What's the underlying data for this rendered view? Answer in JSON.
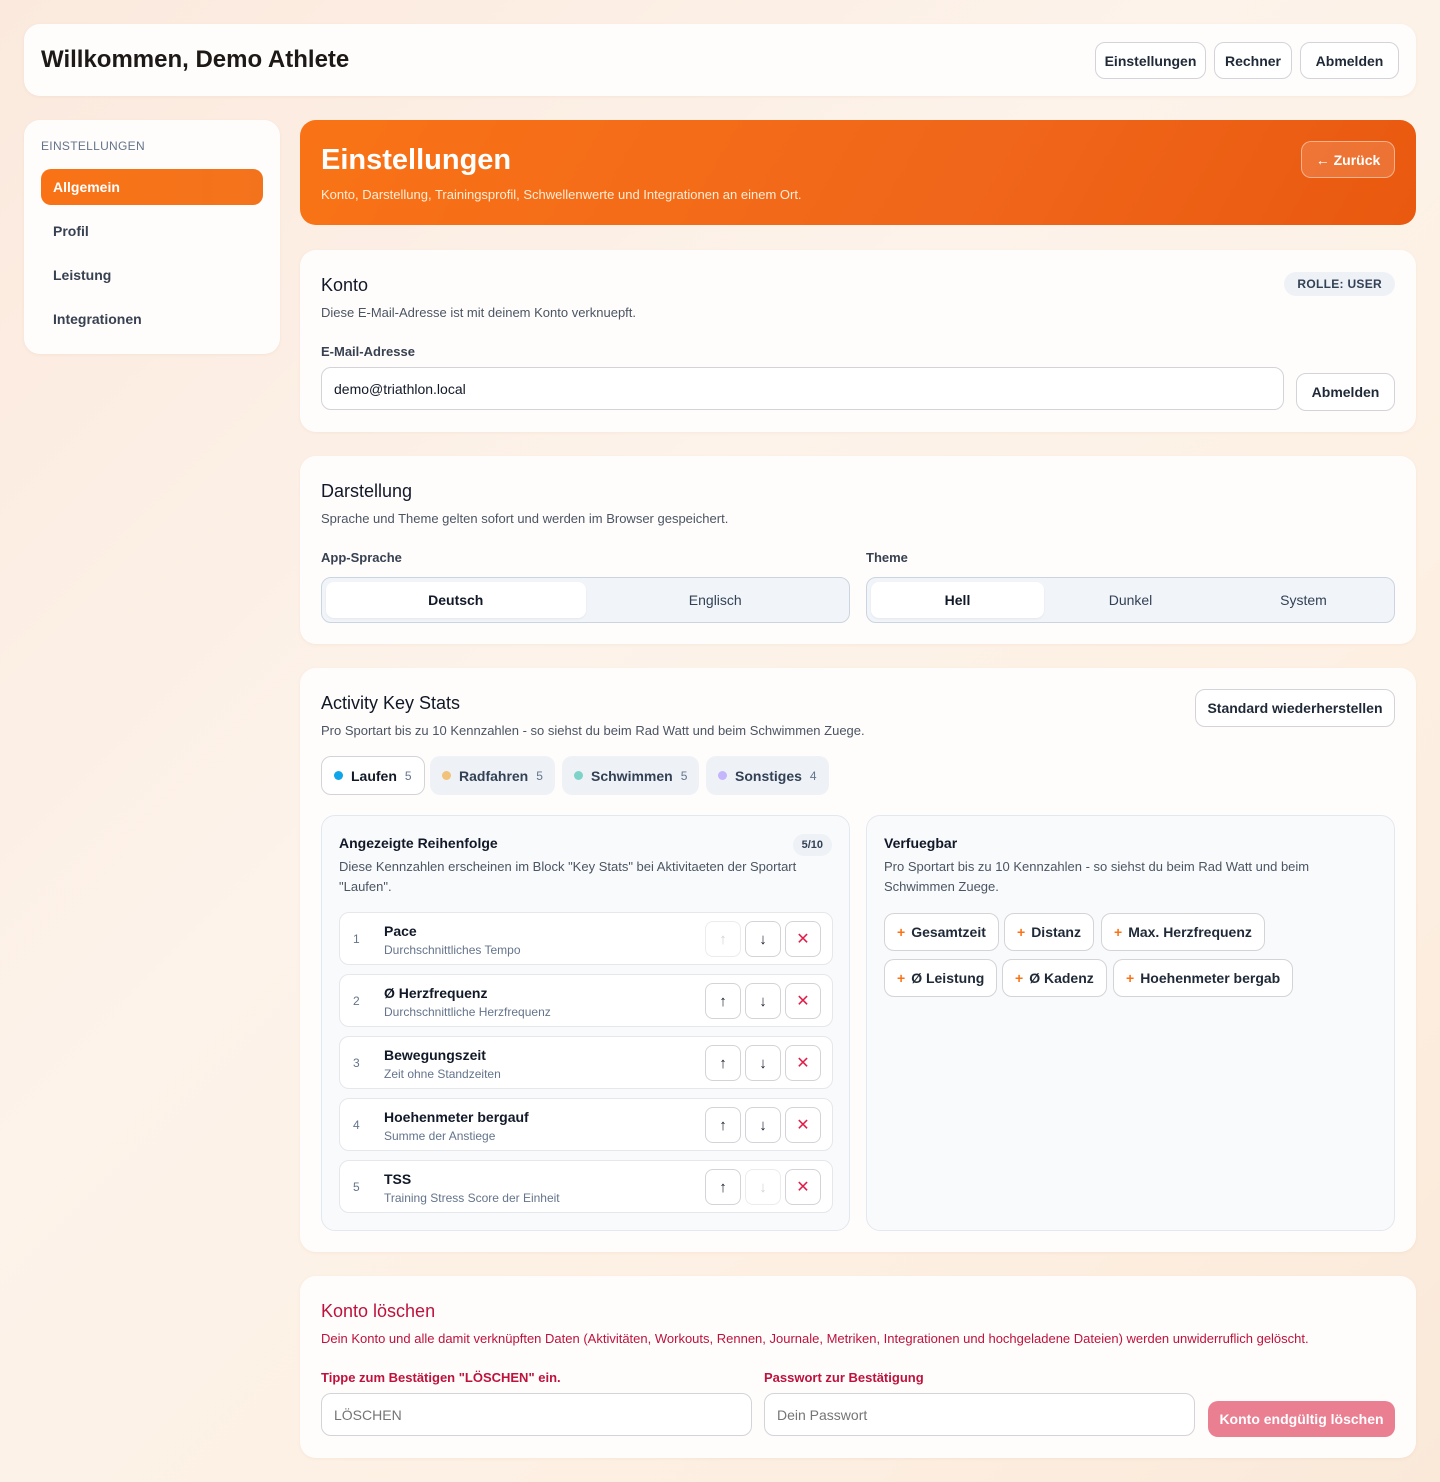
{
  "header": {
    "title": "Willkommen, Demo Athlete",
    "buttons": [
      "Einstellungen",
      "Rechner",
      "Abmelden"
    ]
  },
  "sidebar": {
    "caption": "EINSTELLUNGEN",
    "items": [
      {
        "label": "Allgemein",
        "active": true
      },
      {
        "label": "Profil",
        "active": false
      },
      {
        "label": "Leistung",
        "active": false
      },
      {
        "label": "Integrationen",
        "active": false
      }
    ]
  },
  "hero": {
    "title": "Einstellungen",
    "subtitle": "Konto, Darstellung, Trainingsprofil, Schwellenwerte und Integrationen an einem Ort.",
    "back_label": "← Zurück"
  },
  "account": {
    "title": "Konto",
    "role_badge": "ROLLE: USER",
    "description": "Diese E-Mail-Adresse ist mit deinem Konto verknuepft.",
    "email_label": "E-Mail-Adresse",
    "email_value": "demo@triathlon.local",
    "logout_label": "Abmelden"
  },
  "appearance": {
    "title": "Darstellung",
    "description": "Sprache und Theme gelten sofort und werden im Browser gespeichert.",
    "language_label": "App-Sprache",
    "language_options": [
      "Deutsch",
      "Englisch"
    ],
    "language_selected": "Deutsch",
    "theme_label": "Theme",
    "theme_options": [
      "Hell",
      "Dunkel",
      "System"
    ],
    "theme_selected": "Hell"
  },
  "key_stats": {
    "title": "Activity Key Stats",
    "description": "Pro Sportart bis zu 10 Kennzahlen - so siehst du beim Rad Watt und beim Schwimmen Zuege.",
    "reset_label": "Standard wiederherstellen",
    "sports": [
      {
        "label": "Laufen",
        "count": "5",
        "color": "#0ea5e9",
        "active": true
      },
      {
        "label": "Radfahren",
        "count": "5",
        "color": "#f0c27a",
        "active": false
      },
      {
        "label": "Schwimmen",
        "count": "5",
        "color": "#7dd3c8",
        "active": false
      },
      {
        "label": "Sonstiges",
        "count": "4",
        "color": "#c4b5fd",
        "active": false
      }
    ],
    "shown": {
      "title": "Angezeigte Reihenfolge",
      "count_badge": "5/10",
      "description": "Diese Kennzahlen erscheinen im Block \"Key Stats\" bei Aktivitaeten der Sportart \"Laufen\".",
      "items": [
        {
          "num": "1",
          "name": "Pace",
          "sub": "Durchschnittliches Tempo"
        },
        {
          "num": "2",
          "name": "Ø Herzfrequenz",
          "sub": "Durchschnittliche Herzfrequenz"
        },
        {
          "num": "3",
          "name": "Bewegungszeit",
          "sub": "Zeit ohne Standzeiten"
        },
        {
          "num": "4",
          "name": "Hoehenmeter bergauf",
          "sub": "Summe der Anstiege"
        },
        {
          "num": "5",
          "name": "TSS",
          "sub": "Training Stress Score der Einheit"
        }
      ]
    },
    "available": {
      "title": "Verfuegbar",
      "description": "Pro Sportart bis zu 10 Kennzahlen - so siehst du beim Rad Watt und beim Schwimmen Zuege.",
      "chips": [
        "Gesamtzeit",
        "Distanz",
        "Max. Herzfrequenz",
        "Ø Leistung",
        "Ø Kadenz",
        "Hoehenmeter bergab"
      ]
    },
    "icons": {
      "up": "↑",
      "down": "↓",
      "remove": "✕",
      "plus": "+"
    }
  },
  "delete_account": {
    "title": "Konto löschen",
    "description": "Dein Konto und alle damit verknüpften Daten (Aktivitäten, Workouts, Rennen, Journale, Metriken, Integrationen und hochgeladene Dateien) werden unwiderruflich gelöscht.",
    "confirm_label": "Tippe zum Bestätigen \"LÖSCHEN\" ein.",
    "confirm_placeholder": "LÖSCHEN",
    "password_label": "Passwort zur Bestätigung",
    "password_placeholder": "Dein Passwort",
    "button_label": "Konto endgültig löschen"
  },
  "colors": {
    "accent": "#f97316",
    "danger": "#be123c",
    "danger_button": "#ea7f92"
  }
}
